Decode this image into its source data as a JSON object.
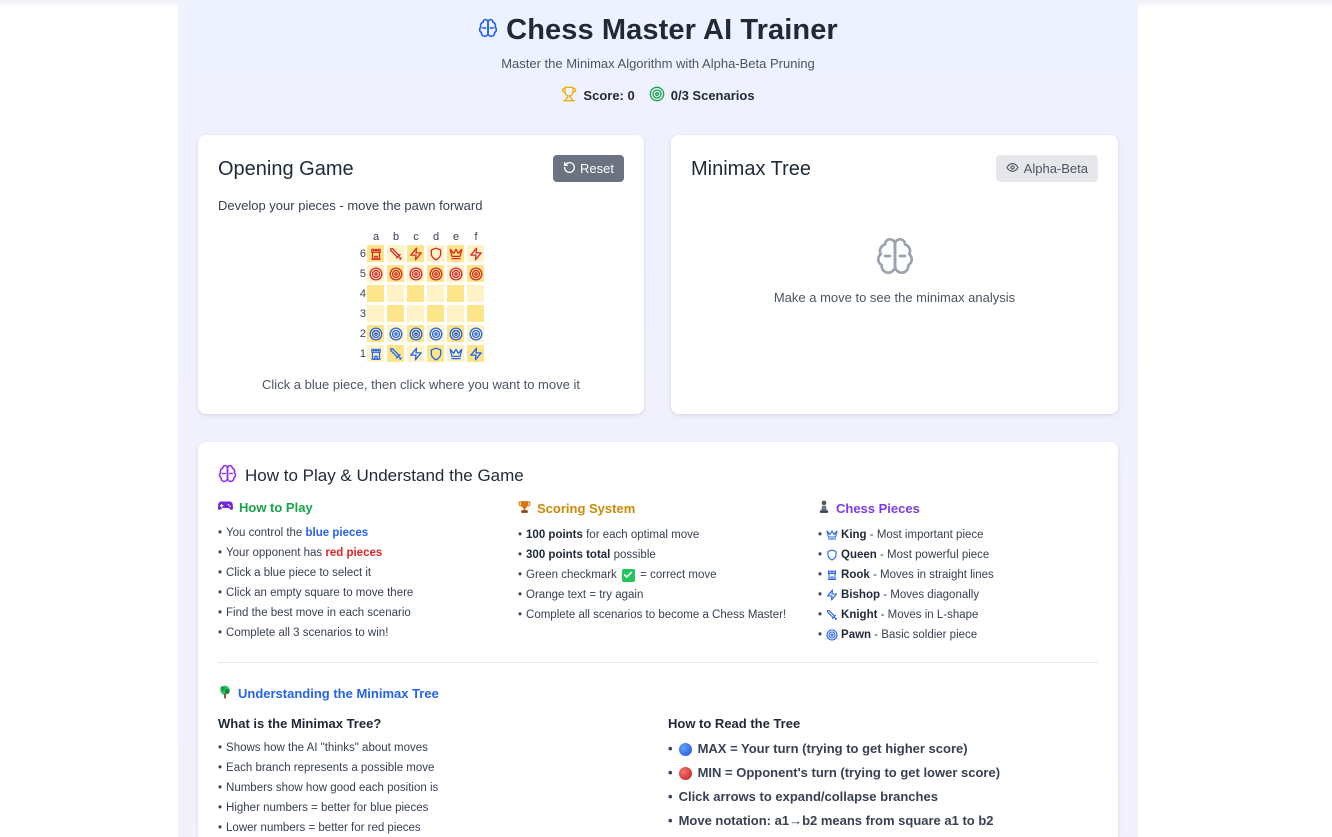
{
  "header": {
    "title": "Chess Master AI Trainer",
    "subtitle": "Master the Minimax Algorithm with Alpha-Beta Pruning",
    "score": "Score: 0",
    "scenarios": "0/3 Scenarios"
  },
  "game": {
    "title": "Opening Game",
    "reset_label": "Reset",
    "description": "Develop your pieces - move the pawn forward",
    "helper": "Click a blue piece, then click where you want to move it",
    "files": [
      "a",
      "b",
      "c",
      "d",
      "e",
      "f"
    ],
    "ranks": [
      "6",
      "5",
      "4",
      "3",
      "2",
      "1"
    ],
    "board": [
      [
        "red-rook-icon",
        "red-knight-icon",
        "red-bishop-icon",
        "red-queen-icon",
        "red-king-icon",
        "red-bishop-icon"
      ],
      [
        "red-pawn-icon",
        "red-pawn-icon",
        "red-pawn-icon",
        "red-pawn-icon",
        "red-pawn-icon",
        "red-pawn-icon"
      ],
      [
        "",
        "",
        "",
        "",
        "",
        ""
      ],
      [
        "",
        "",
        "",
        "",
        "",
        ""
      ],
      [
        "blue-pawn-icon",
        "blue-pawn-icon",
        "blue-pawn-icon",
        "blue-pawn-icon",
        "blue-pawn-icon",
        "blue-pawn-icon"
      ],
      [
        "blue-rook-icon",
        "blue-knight-icon",
        "blue-bishop-icon",
        "blue-queen-icon",
        "blue-king-icon",
        "blue-bishop-icon"
      ]
    ]
  },
  "tree": {
    "title": "Minimax Tree",
    "toggle_label": "Alpha-Beta",
    "empty_text": "Make a move to see the minimax analysis"
  },
  "guide": {
    "title": "How to Play & Understand the Game",
    "how_to_play": {
      "heading": "How to Play",
      "item1_pre": "You control the ",
      "item1_em": "blue pieces",
      "item2_pre": "Your opponent has ",
      "item2_em": "red pieces",
      "item3": "Click a blue piece to select it",
      "item4": "Click an empty square to move there",
      "item5": "Find the best move in each scenario",
      "item6": "Complete all 3 scenarios to win!"
    },
    "scoring": {
      "heading": "Scoring System",
      "item1_b": "100 points",
      "item1_rest": " for each optimal move",
      "item2_b": "300 points total",
      "item2_rest": " possible",
      "item3_pre": "Green checkmark ",
      "item3_post": " = correct move",
      "item4": "Orange text = try again",
      "item5": "Complete all scenarios to become a Chess Master!"
    },
    "pieces": {
      "heading": "Chess Pieces",
      "items": [
        {
          "icon": "king-icon",
          "name": "King",
          "desc": " - Most important piece"
        },
        {
          "icon": "queen-icon",
          "name": "Queen",
          "desc": " - Most powerful piece"
        },
        {
          "icon": "rook-icon",
          "name": "Rook",
          "desc": " - Moves in straight lines"
        },
        {
          "icon": "bishop-icon",
          "name": "Bishop",
          "desc": " - Moves diagonally"
        },
        {
          "icon": "knight-icon",
          "name": "Knight",
          "desc": " - Moves in L-shape"
        },
        {
          "icon": "pawn-icon",
          "name": "Pawn",
          "desc": " - Basic soldier piece"
        }
      ]
    },
    "minimax": {
      "heading": "Understanding the Minimax Tree",
      "what_title": "What is the Minimax Tree?",
      "what_items": [
        "Shows how the AI \"thinks\" about moves",
        "Each branch represents a possible move",
        "Numbers show how good each position is",
        "Higher numbers = better for blue pieces",
        "Lower numbers = better for red pieces"
      ],
      "read_title": "How to Read the Tree",
      "read_items": [
        "MAX = Your turn (trying to get higher score)",
        "MIN = Opponent's turn (trying to get lower score)",
        "Click arrows to expand/collapse branches",
        "Move notation: a1→b2 means from square a1 to b2"
      ]
    }
  },
  "colors": {
    "blue_piece": "#2563eb",
    "red_piece": "#dc2626",
    "green_heading": "#16a34a",
    "orange_heading": "#ca8a04",
    "purple_heading": "#7c3aed",
    "blue_heading": "#2563eb",
    "board_light": "#fef3c7",
    "board_dark": "#fde68a"
  }
}
